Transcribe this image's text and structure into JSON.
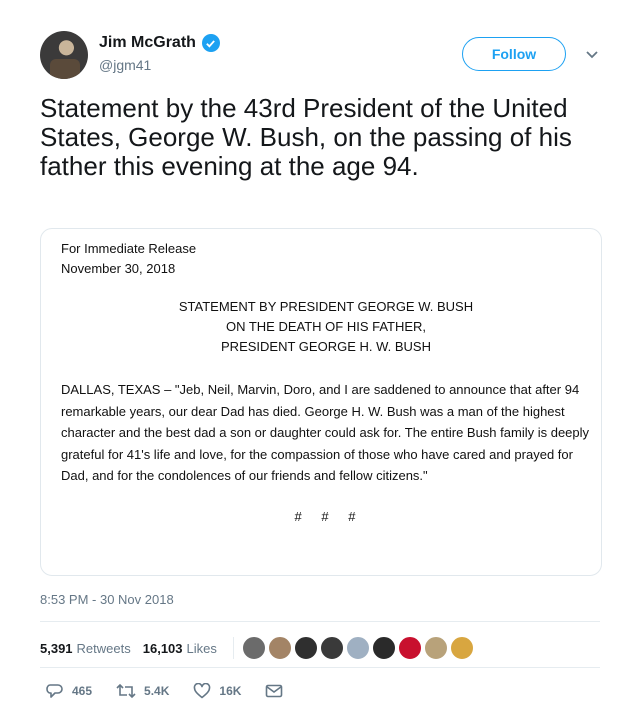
{
  "author": {
    "display_name": "Jim McGrath",
    "handle": "@jgm41",
    "verified": true
  },
  "follow_label": "Follow",
  "tweet_text": "Statement by the 43rd President of the United States, George W. Bush, on the passing of his father this evening at the age 94.",
  "statement": {
    "release_label": "For Immediate Release",
    "release_date": "November 30, 2018",
    "title_lines": [
      "STATEMENT BY PRESIDENT GEORGE W. BUSH",
      "ON THE DEATH OF HIS FATHER,",
      "PRESIDENT GEORGE H. W. BUSH"
    ],
    "body": "DALLAS, TEXAS – \"Jeb, Neil, Marvin, Doro, and I are saddened to announce that after 94 remarkable years, our dear Dad has died. George H. W. Bush was a man of the highest character and the best dad a son or daughter could ask for. The entire Bush family is deeply grateful for 41's life and love, for the compassion of those who have cared and prayed for Dad, and for the condolences of our friends and fellow citizens.\"",
    "end_marks": "# # #"
  },
  "timestamp": "8:53 PM - 30 Nov 2018",
  "stats": {
    "retweets_count": "5,391",
    "retweets_label": "Retweets",
    "likes_count": "16,103",
    "likes_label": "Likes"
  },
  "liker_colors": [
    "#6b6b6b",
    "#a38466",
    "#2f2f2f",
    "#3a3a3a",
    "#9fb0c2",
    "#2a2a2a",
    "#c8102e",
    "#b8a27a",
    "#d8a640"
  ],
  "actions": {
    "reply_count": "465",
    "retweet_count": "5.4K",
    "like_count": "16K"
  },
  "icons": {
    "verified": "verified-badge-icon",
    "caret": "chevron-down-icon",
    "reply": "reply-icon",
    "retweet": "retweet-icon",
    "like": "heart-icon",
    "message": "envelope-icon"
  },
  "colors": {
    "accent": "#1da1f2",
    "muted": "#657786",
    "text": "#14171a",
    "border": "#e1e8ed"
  }
}
